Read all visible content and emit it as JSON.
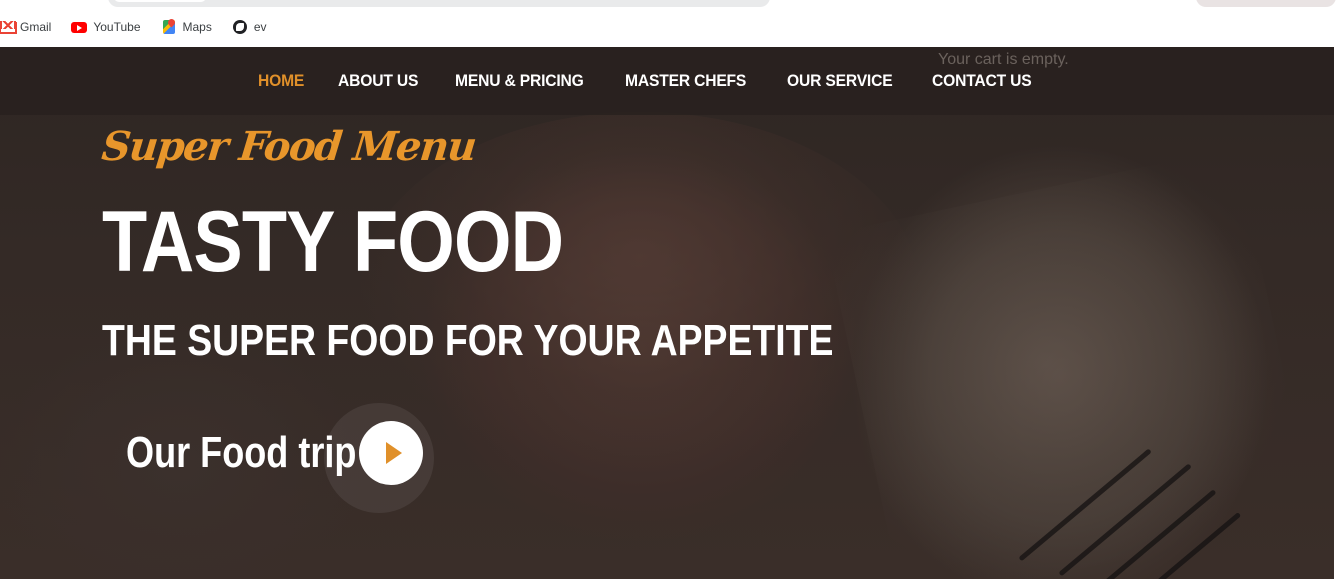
{
  "bookmarks": [
    {
      "label": "Gmail",
      "icon": "gmail-icon"
    },
    {
      "label": "YouTube",
      "icon": "youtube-icon"
    },
    {
      "label": "Maps",
      "icon": "maps-icon"
    },
    {
      "label": "ev",
      "icon": "globe-icon"
    }
  ],
  "nav": {
    "items": [
      {
        "label": "HOME",
        "active": true
      },
      {
        "label": "ABOUT US",
        "active": false
      },
      {
        "label": "MENU & PRICING",
        "active": false
      },
      {
        "label": "MASTER CHEFS",
        "active": false
      },
      {
        "label": "OUR SERVICE",
        "active": false
      },
      {
        "label": "CONTACT US",
        "active": false
      }
    ],
    "cart_text": "Your cart is empty."
  },
  "hero": {
    "script_title": "Super Food Menu",
    "title": "TASTY FOOD",
    "subtitle": "THE SUPER FOOD FOR YOUR APPETITE",
    "video_label": "Our Food trip"
  },
  "colors": {
    "accent": "#e0902a",
    "nav_text": "#ffffff",
    "hero_bg": "#2e2623"
  }
}
